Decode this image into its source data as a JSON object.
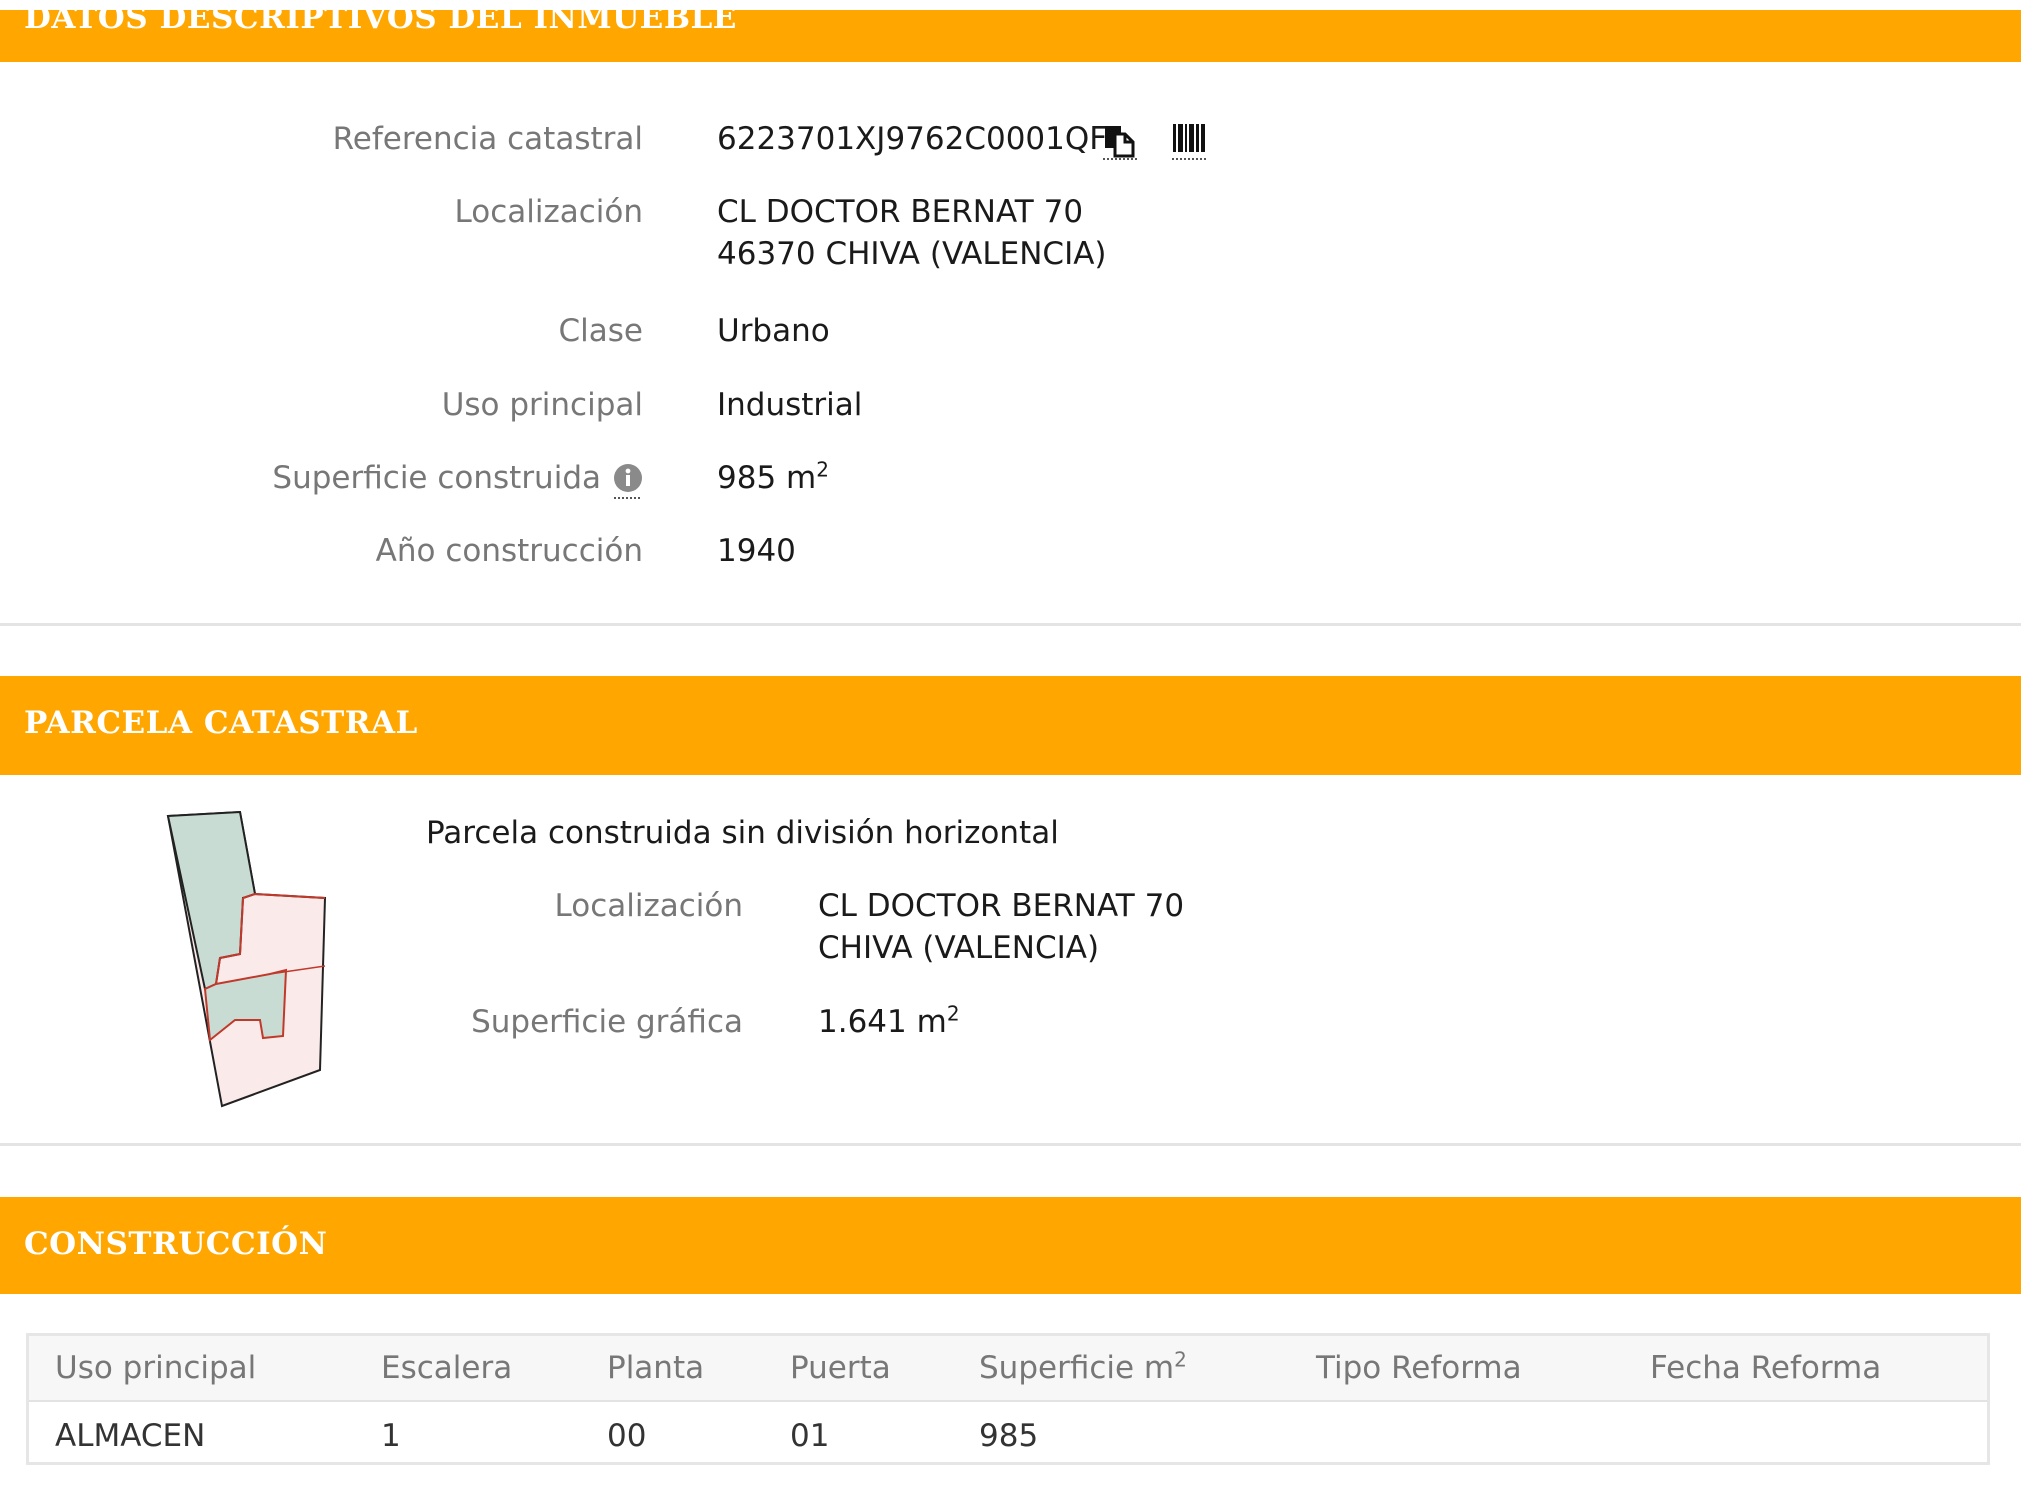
{
  "sections": {
    "datos": {
      "title": "DATOS DESCRIPTIVOS DEL INMUEBLE"
    },
    "parcela": {
      "title": "PARCELA CATASTRAL"
    },
    "construccion": {
      "title": "CONSTRUCCIÓN"
    }
  },
  "inmueble": {
    "referencia": {
      "label": "Referencia catastral",
      "value": "6223701XJ9762C0001QF"
    },
    "localizacion": {
      "label": "Localización",
      "line1": "CL DOCTOR BERNAT 70",
      "line2": "46370 CHIVA (VALENCIA)"
    },
    "clase": {
      "label": "Clase",
      "value": "Urbano"
    },
    "uso": {
      "label": "Uso principal",
      "value": "Industrial"
    },
    "superficie": {
      "label": "Superficie construida",
      "value": "985 m",
      "unit_sup": "2"
    },
    "anio": {
      "label": "Año construcción",
      "value": "1940"
    }
  },
  "parcela": {
    "subtitle": "Parcela construida sin división horizontal",
    "localizacion": {
      "label": "Localización",
      "line1": "CL DOCTOR BERNAT 70",
      "line2": "CHIVA (VALENCIA)"
    },
    "superficie": {
      "label": "Superficie gráfica",
      "value": "1.641 m",
      "unit_sup": "2"
    }
  },
  "construccion": {
    "headers": [
      "Uso principal",
      "Escalera",
      "Planta",
      "Puerta",
      "Superficie m",
      "Tipo Reforma",
      "Fecha Reforma"
    ],
    "header_sup": "2",
    "rows": [
      [
        "ALMACEN",
        "1",
        "00",
        "01",
        "985",
        "",
        ""
      ]
    ]
  },
  "colors": {
    "accent": "#ffa600",
    "label": "#777777",
    "parcel_fill": "#c9dcd3",
    "building_outline": "#c0392b"
  },
  "icons": [
    "copy-icon",
    "barcode-icon",
    "info-icon"
  ]
}
